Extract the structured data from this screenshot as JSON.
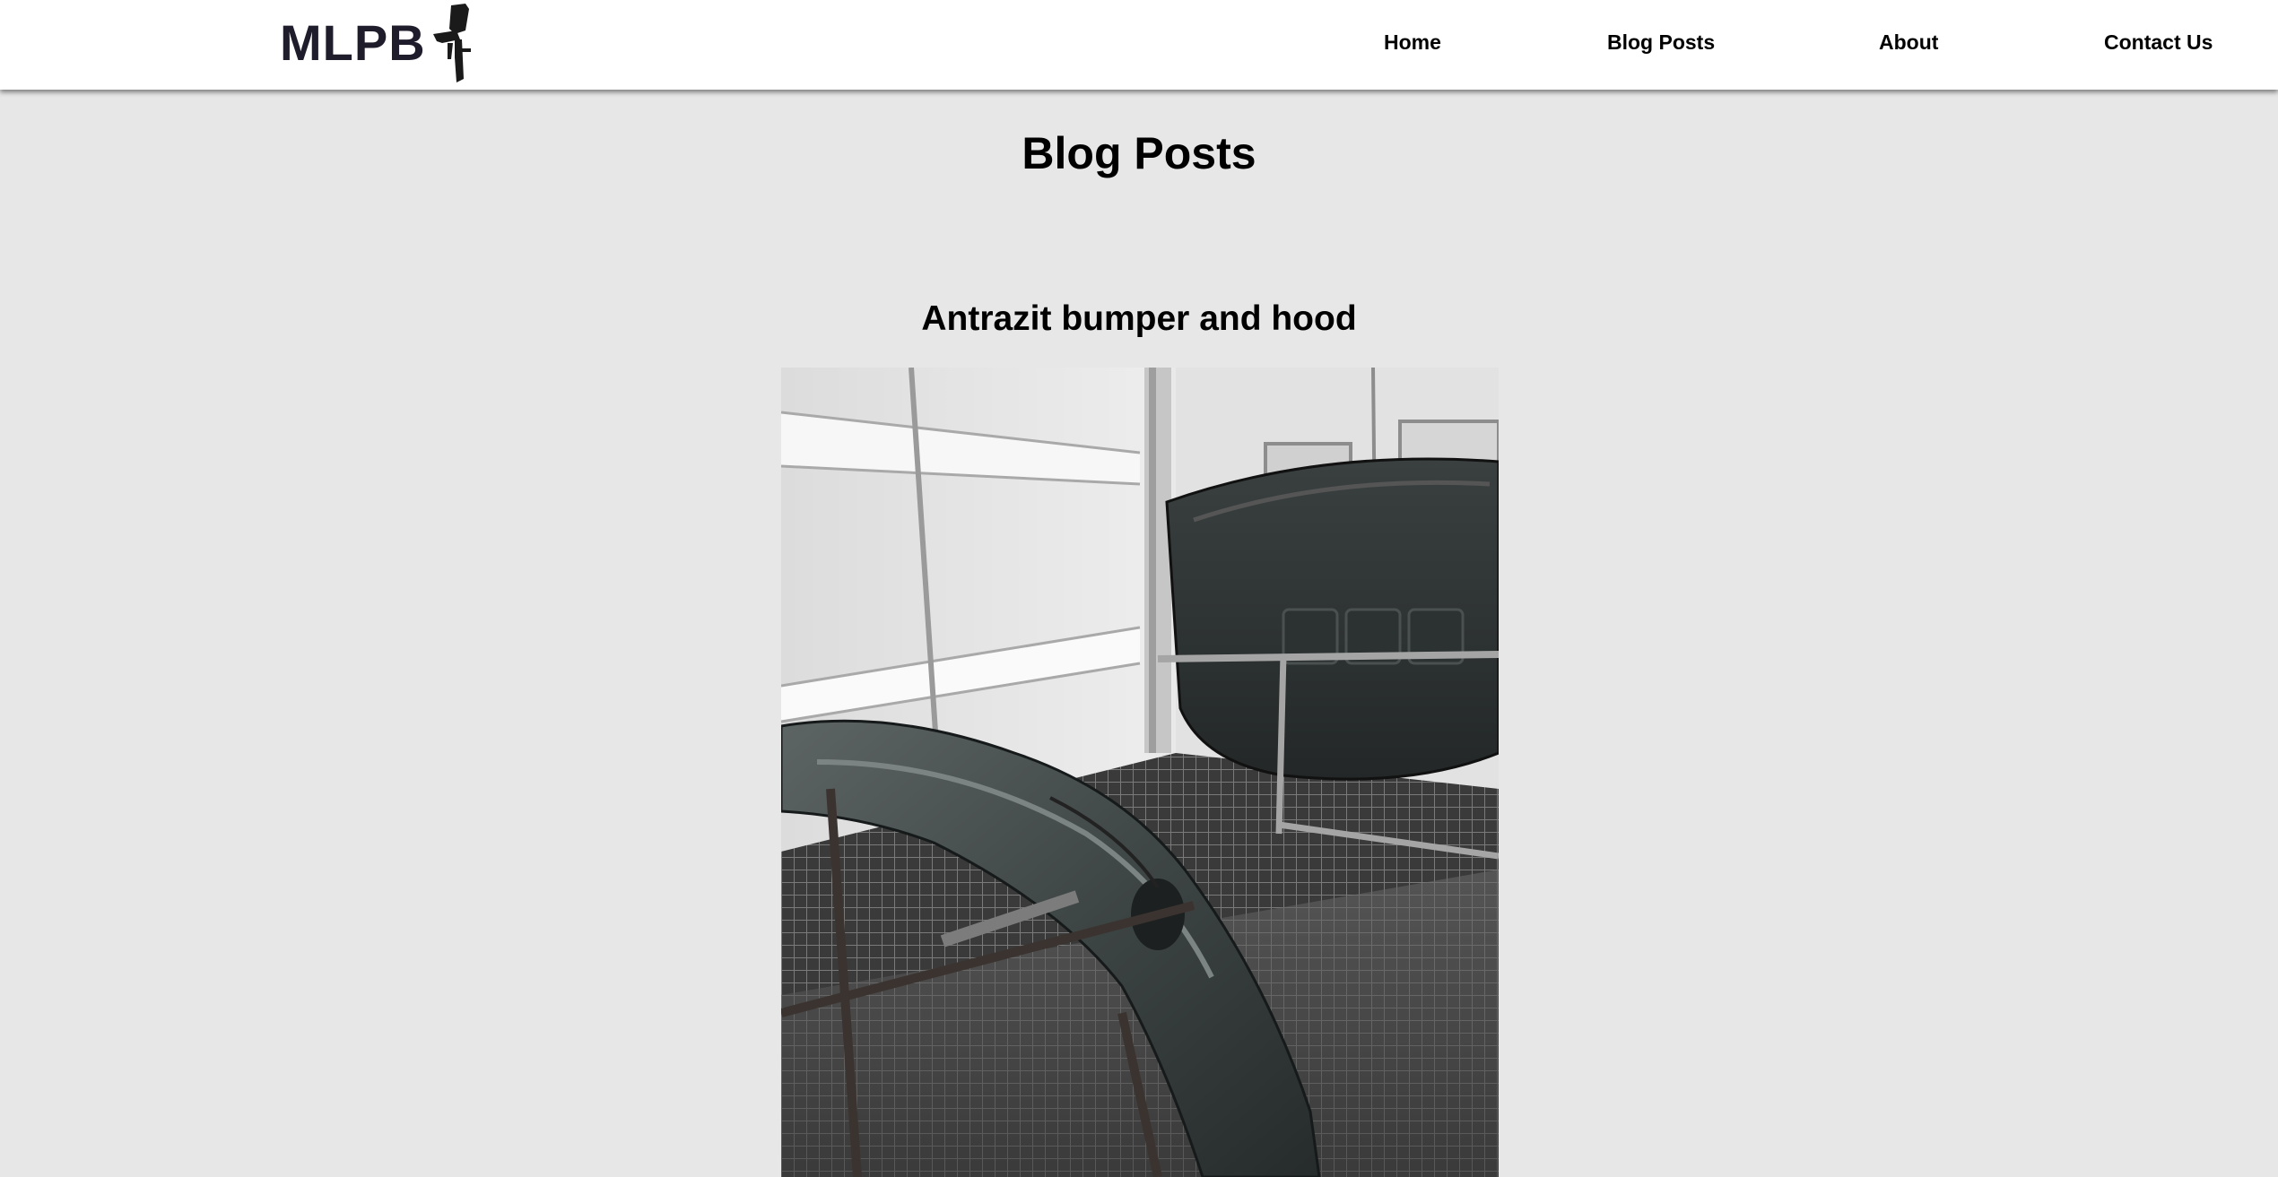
{
  "header": {
    "logo_text": "MLPB",
    "logo_icon": "spray-gun-icon",
    "nav": {
      "home": "Home",
      "blog_posts": "Blog Posts",
      "about": "About",
      "contact_us": "Contact Us"
    }
  },
  "main": {
    "page_title": "Blog Posts",
    "posts": [
      {
        "title": "Antrazit bumper and hood",
        "image": "photo of anthracite painted car bumper and hood in a paint booth"
      }
    ]
  },
  "colors": {
    "page_background": "#e7e7e7",
    "header_background": "#ffffff",
    "logo_text": "#1f1d2b",
    "text": "#000000"
  }
}
